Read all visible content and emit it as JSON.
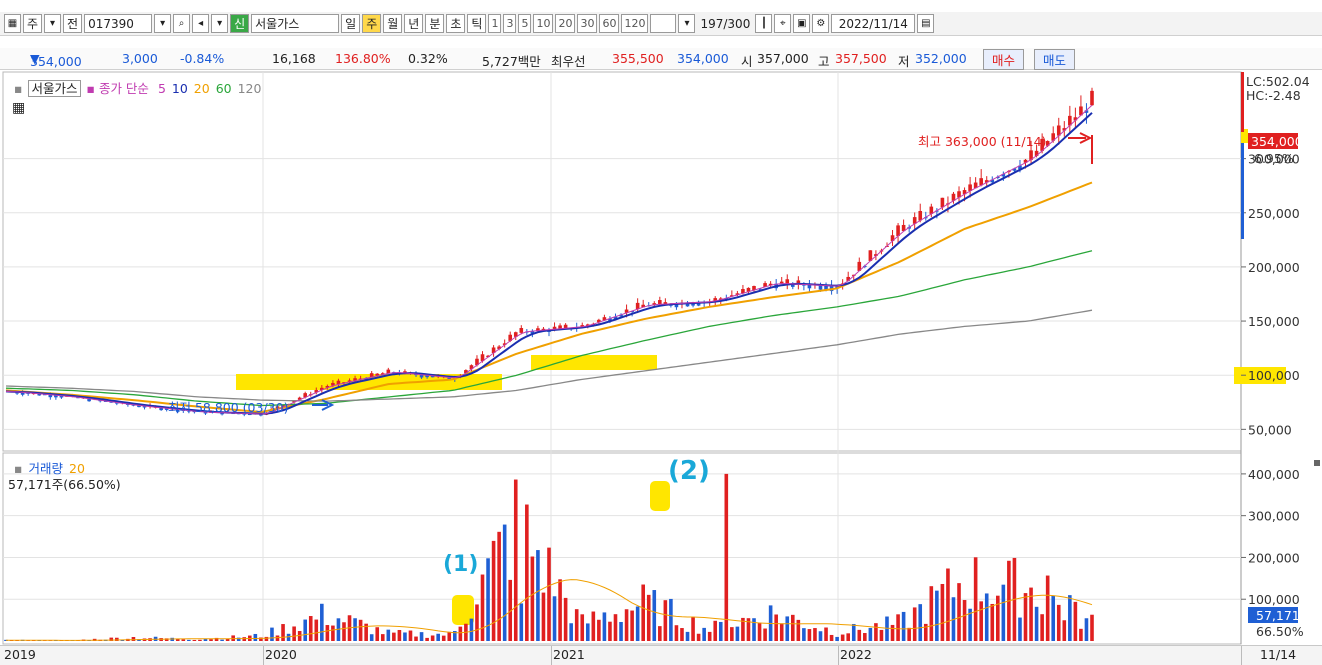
{
  "toolbar": {
    "chart_type": "주",
    "prev_label": "전",
    "code": "017390",
    "new_badge": "신",
    "name": "서울가스",
    "periods": [
      "일",
      "주",
      "월",
      "년",
      "분",
      "초",
      "틱"
    ],
    "active_period": "주",
    "intervals": [
      "1",
      "3",
      "5",
      "10",
      "20",
      "30",
      "60",
      "120"
    ],
    "count": "197",
    "count_total": "/300",
    "date": "2022/11/14"
  },
  "quote": {
    "price": "354,000",
    "change": "3,000",
    "change_pct": "-0.84%",
    "volume": "16,168",
    "vol_ratio": "136.80%",
    "turnover": "0.32%",
    "amount": "5,727백만",
    "best_label": "최우선",
    "ask": "355,500",
    "bid": "354,000",
    "open_label": "시",
    "open": "357,000",
    "high_label": "고",
    "high": "357,500",
    "low_label": "저",
    "low": "352,000",
    "buy_label": "매수",
    "sell_label": "매도"
  },
  "price_legend": {
    "name": "서울가스",
    "ma_label": "종가 단순",
    "ma_periods": [
      "5",
      "10",
      "20",
      "60",
      "120"
    ]
  },
  "annotations": {
    "high_text": "최고 363,000 (11/14)",
    "low_text": "최저 58,800 (03/30)",
    "lc": "LC:502.04",
    "hc": "HC:-2.48",
    "last_price": "354,000",
    "last_pct": "6.95%",
    "mark_1": "(1)",
    "mark_2": "(2)"
  },
  "volume_legend": {
    "label": "거래량",
    "period": "20",
    "last": "57,171주(66.50%)",
    "last_value": "57,171",
    "last_pct": "66.50%"
  },
  "date_axis": [
    "2019",
    "2020",
    "2021",
    "2022",
    "11/14"
  ],
  "colors": {
    "up": "#e02020",
    "down": "#1f5fd4",
    "ma5": "#c03bb0",
    "ma10": "#1a2fb0",
    "ma20": "#f0a000",
    "ma60": "#2aa63a",
    "ma120": "#888888",
    "highlight": "#ffe600"
  },
  "chart_data": [
    {
      "type": "line",
      "title": "서울가스 종가 단순 5 10 20 60 120",
      "x": [
        "2019",
        "2020",
        "2021",
        "2022",
        "11/14"
      ],
      "ylim": [
        30000,
        380000
      ],
      "yticks": [
        50000,
        100000,
        150000,
        200000,
        250000,
        300000,
        354000
      ],
      "ytick_labels": [
        "50,000",
        "100,000",
        "150,000",
        "200,000",
        "250,000",
        "300,000",
        "354,000"
      ],
      "series": [
        {
          "name": "종가",
          "values": [
            85000,
            80000,
            72000,
            66000,
            64000,
            90000,
            103000,
            97000,
            140000,
            145000,
            165000,
            168000,
            185000,
            182000,
            235000,
            270000,
            300000,
            354000
          ]
        },
        {
          "name": "20",
          "values": [
            86000,
            82000,
            77000,
            71000,
            66000,
            78000,
            92000,
            96000,
            120000,
            138000,
            152000,
            163000,
            172000,
            180000,
            205000,
            235000,
            255000,
            278000
          ]
        },
        {
          "name": "60",
          "values": [
            88000,
            86000,
            82000,
            76000,
            72000,
            74000,
            80000,
            86000,
            100000,
            118000,
            132000,
            145000,
            155000,
            163000,
            173000,
            188000,
            200000,
            215000
          ]
        },
        {
          "name": "120",
          "values": [
            90000,
            88000,
            85000,
            80000,
            77000,
            76000,
            78000,
            80000,
            86000,
            96000,
            104000,
            112000,
            120000,
            128000,
            138000,
            145000,
            150000,
            160000
          ]
        }
      ]
    },
    {
      "type": "bar",
      "title": "거래량 20",
      "ylim": [
        0,
        450000
      ],
      "yticks": [
        100000,
        200000,
        300000,
        400000
      ],
      "ytick_labels": [
        "100,000",
        "200,000",
        "300,000",
        "400,000"
      ],
      "values": [
        3000,
        2000,
        12000,
        6000,
        18000,
        90000,
        25000,
        22000,
        400000,
        60000,
        130000,
        40000,
        95000,
        30000,
        60000,
        205000,
        180000,
        57171
      ]
    }
  ]
}
